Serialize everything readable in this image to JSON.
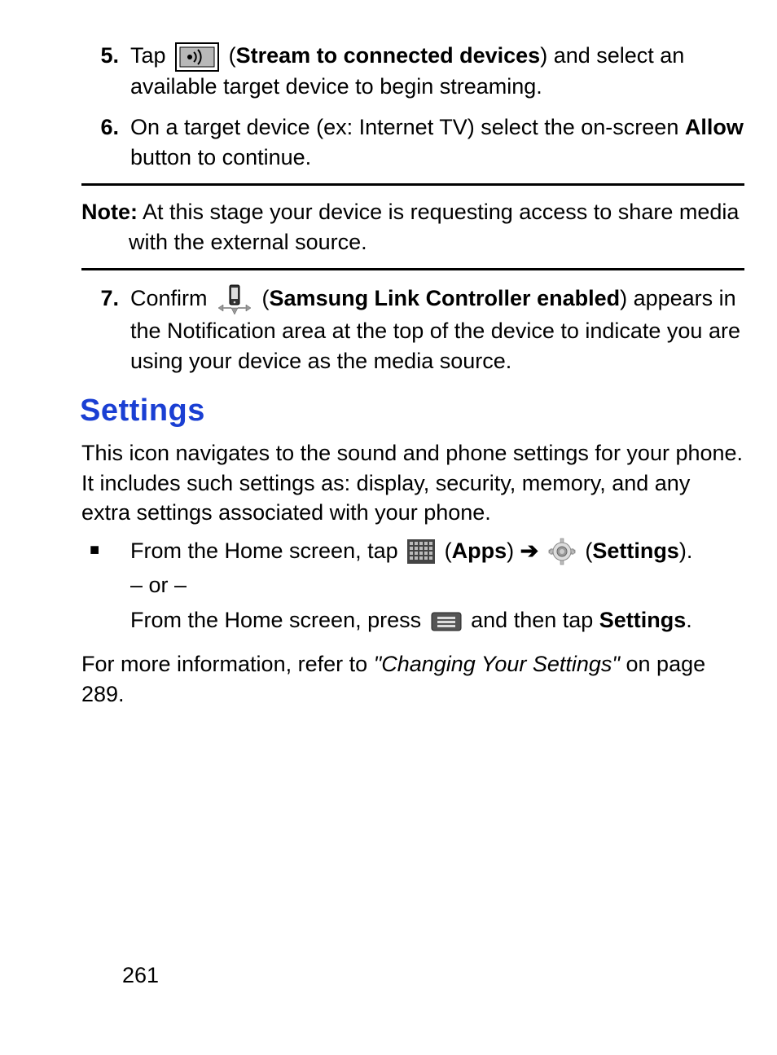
{
  "steps": {
    "s5": {
      "num": "5.",
      "t1": "Tap ",
      "iconLabel": "Stream to connected devices",
      "t2": ") and select an available target device to begin streaming."
    },
    "s6": {
      "num": "6.",
      "t1": "On a target device (ex: Internet TV) select the on-screen ",
      "bold": "Allow",
      "t2": " button to continue."
    },
    "s7": {
      "num": "7.",
      "t1": "Confirm ",
      "iconLabel": "Samsung Link Controller enabled",
      "t2": ") appears in the Notification area at the top of the device to indicate you are using your device as the media source."
    }
  },
  "note": {
    "label": "Note:",
    "line1": " At this stage your device is requesting access to share media",
    "line2": "with the external source."
  },
  "section": {
    "heading": "Settings",
    "intro": "This icon navigates to the sound and phone settings for your phone. It includes such settings as: display, security, memory, and any extra settings associated with your phone.",
    "bullet": {
      "t1": "From the Home screen, tap ",
      "apps": "Apps",
      "arrow": " ➔ ",
      "settings": "Settings",
      "close": ").",
      "or": "– or –",
      "t2a": "From the Home screen, press ",
      "t2b": " and then tap ",
      "t2bold": "Settings",
      "t2end": "."
    },
    "ref1": "For more information, refer to ",
    "refItalic": "\"Changing Your Settings\"",
    "ref2": " on page 289."
  },
  "pageNumber": "261"
}
